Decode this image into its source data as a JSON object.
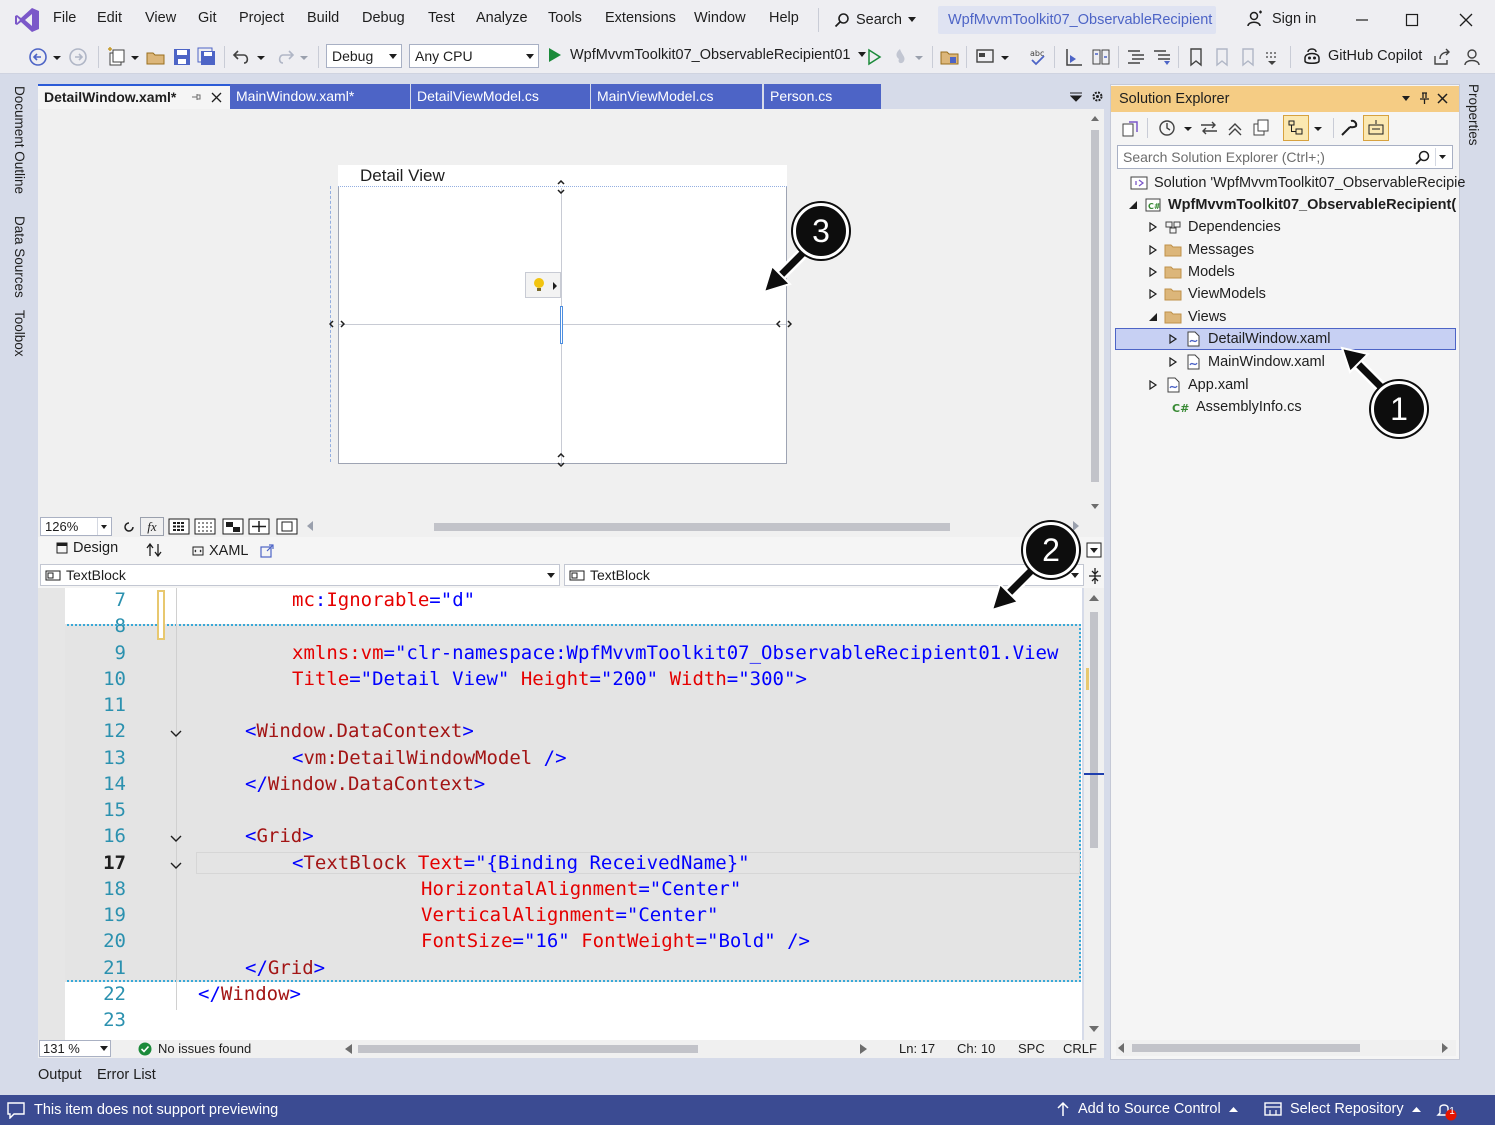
{
  "menubar": {
    "items": [
      "File",
      "Edit",
      "View",
      "Git",
      "Project",
      "Build",
      "Debug",
      "Test",
      "Analyze",
      "Tools",
      "Extensions",
      "Window",
      "Help"
    ],
    "search_label": "Search",
    "solution_title": "WpfMvvmToolkit07_ObservableRecipient",
    "sign_in": "Sign in"
  },
  "toolbar": {
    "configuration": "Debug",
    "platform": "Any CPU",
    "start_target": "WpfMvvmToolkit07_ObservableRecipient01",
    "copilot": "GitHub Copilot"
  },
  "left_rail": {
    "tabs": [
      "Document Outline",
      "Data Sources",
      "Toolbox"
    ]
  },
  "right_rail": {
    "tabs": [
      "Properties"
    ]
  },
  "doc_tabs": [
    {
      "label": "DetailWindow.xaml*",
      "active": true
    },
    {
      "label": "MainWindow.xaml*",
      "active": false
    },
    {
      "label": "DetailViewModel.cs",
      "active": false
    },
    {
      "label": "MainViewModel.cs",
      "active": false
    },
    {
      "label": "Person.cs",
      "active": false
    }
  ],
  "designer": {
    "window_title": "Detail View",
    "zoom": "126%",
    "design_tab": "Design",
    "xaml_tab": "XAML"
  },
  "navbar": {
    "left": "TextBlock",
    "right": "TextBlock"
  },
  "code_lines": [
    {
      "n": "7"
    },
    {
      "n": "8"
    },
    {
      "n": "9"
    },
    {
      "n": "10"
    },
    {
      "n": "11"
    },
    {
      "n": "12"
    },
    {
      "n": "13"
    },
    {
      "n": "14"
    },
    {
      "n": "15"
    },
    {
      "n": "16"
    },
    {
      "n": "17"
    },
    {
      "n": "18"
    },
    {
      "n": "19"
    },
    {
      "n": "20"
    },
    {
      "n": "21"
    },
    {
      "n": "22"
    },
    {
      "n": "23"
    }
  ],
  "code": {
    "l7": {
      "prefix": "mc",
      "colon": ":",
      "attr": "Ignorable",
      "eq": "=",
      "val": "\"d\""
    },
    "l9": {
      "attr": "xmlns:vm",
      "eq": "=",
      "val": "\"clr-namespace:WpfMvvmToolkit07_ObservableRecipient01.View"
    },
    "l10": {
      "a1": "Title",
      "v1": "\"Detail View\"",
      "a2": "Height",
      "v2": "\"200\"",
      "a3": "Width",
      "v3": "\"300\"",
      "end": ">"
    },
    "l12": {
      "open": "<",
      "tag": "Window.DataContext",
      "close": ">"
    },
    "l13": {
      "open": "<",
      "tag": "vm:DetailWindowModel",
      "close": " />"
    },
    "l14": {
      "open": "</",
      "tag": "Window.DataContext",
      "close": ">"
    },
    "l16": {
      "open": "<",
      "tag": "Grid",
      "close": ">"
    },
    "l17": {
      "open": "<",
      "tag": "TextBlock",
      "attr": "Text",
      "val": "\"{Binding ReceivedName}\""
    },
    "l18": {
      "attr": "HorizontalAlignment",
      "val": "\"Center\""
    },
    "l19": {
      "attr": "VerticalAlignment",
      "val": "\"Center\""
    },
    "l20": {
      "a1": "FontSize",
      "v1": "\"16\"",
      "a2": "FontWeight",
      "v2": "\"Bold\"",
      "end": " />"
    },
    "l21": {
      "open": "</",
      "tag": "Grid",
      "close": ">"
    },
    "l22": {
      "open": "</",
      "tag": "Window",
      "close": ">"
    }
  },
  "editor_status": {
    "zoom": "131 %",
    "issues": "No issues found",
    "ln": "Ln: 17",
    "ch": "Ch: 10",
    "spc": "SPC",
    "crlf": "CRLF"
  },
  "bottom_tabs": [
    "Output",
    "Error List"
  ],
  "solution_explorer": {
    "title": "Solution Explorer",
    "search_placeholder": "Search Solution Explorer (Ctrl+;)",
    "tree": [
      {
        "label": "Solution 'WpfMvvmToolkit07_ObservableRecipie",
        "indent": 0,
        "icon": "solution-icon"
      },
      {
        "label": "WpfMvvmToolkit07_ObservableRecipient(",
        "indent": 1,
        "icon": "csharp-project-icon",
        "bold": true,
        "expanded": true
      },
      {
        "label": "Dependencies",
        "indent": 2,
        "icon": "dependencies-icon"
      },
      {
        "label": "Messages",
        "indent": 2,
        "icon": "folder-icon"
      },
      {
        "label": "Models",
        "indent": 2,
        "icon": "folder-icon"
      },
      {
        "label": "ViewModels",
        "indent": 2,
        "icon": "folder-icon"
      },
      {
        "label": "Views",
        "indent": 2,
        "icon": "folder-icon",
        "expanded": true
      },
      {
        "label": "DetailWindow.xaml",
        "indent": 3,
        "icon": "xaml-file-icon",
        "selected": true
      },
      {
        "label": "MainWindow.xaml",
        "indent": 3,
        "icon": "xaml-file-icon"
      },
      {
        "label": "App.xaml",
        "indent": 2,
        "icon": "xaml-file-icon"
      },
      {
        "label": "AssemblyInfo.cs",
        "indent": 2,
        "icon": "csharp-file-icon"
      }
    ]
  },
  "statusbar": {
    "message": "This item does not support previewing",
    "source_control": "Add to Source Control",
    "repository": "Select Repository",
    "notification_count": "1"
  },
  "callouts": [
    "1",
    "2",
    "3"
  ],
  "colors": {
    "accent": "#4d64c6",
    "statusbar": "#3b4b92",
    "highlight_border": "#38a9d8",
    "sol_header": "#f5cc84"
  }
}
